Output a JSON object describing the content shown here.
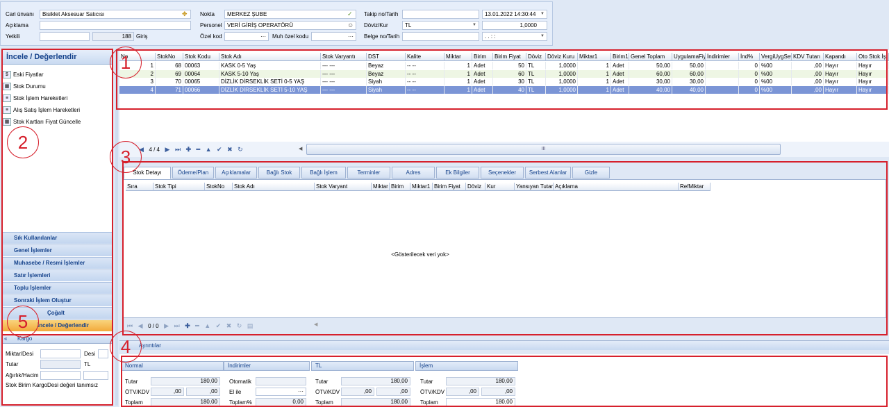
{
  "header": {
    "cari_label": "Cari ünvanı",
    "cari_value": "Bisiklet Aksesuar Satıcısı",
    "aciklama_label": "Açıklama",
    "yetkili_label": "Yetkili",
    "yetkili_num": "188",
    "giris_label": "Giriş",
    "nokta_label": "Nokta",
    "nokta_value": "MERKEZ ŞUBE",
    "personel_label": "Personel",
    "personel_value": "VERİ GİRİŞ OPERATÖRÜ",
    "ozelkod_label": "Özel kod",
    "ozelkod_dots": "···",
    "muhozel_label": "Muh özel kodu",
    "muhozel_dots": "···",
    "takip_label": "Takip no/Tarih",
    "takip_date": "13.01.2022 14:30:44",
    "doviz_label": "Döviz/Kur",
    "doviz_value": "TL",
    "kur_value": "1,0000",
    "belge_label": "Belge no/Tarih",
    "belge_date": ". .    : :"
  },
  "left": {
    "title": "İncele / Değerlendir",
    "items": [
      {
        "label": "Eski Fiyatlar"
      },
      {
        "label": "Stok Durumu"
      },
      {
        "label": "Stok İşlem Hareketleri"
      },
      {
        "label": "Alış Satış İşlem Hareketleri"
      },
      {
        "label": "Stok Kartları Fiyat Güncelle"
      }
    ],
    "accordion": [
      "Sık Kullanılanlar",
      "Genel İşlemler",
      "Muhasebe / Resmi İşlemler",
      "Satır İşlemleri",
      "Toplu İşlemler",
      "Sonraki İşlem Oluştur",
      "Çoğalt",
      "İncele / Değerlendir"
    ],
    "kargo_title": "Kargo",
    "kargo_miktar": "Miktar/Desi",
    "kargo_desi": "Desi",
    "kargo_tutar": "Tutar",
    "kargo_tl": "TL",
    "kargo_agirlik": "Ağırlık/Hacim",
    "kargo_msg": "Stok Birim KargoDesi değeri tanımsız"
  },
  "main_grid": {
    "columns": [
      "No",
      "StokNo",
      "Stok Kodu",
      "Stok Adı",
      "Stok Varyantı",
      "DST",
      "Kalite",
      "Miktar",
      "Birim",
      "Birim Fiyat",
      "Döviz",
      "Döviz Kuru",
      "Miktar1",
      "Birim1",
      "Genel Toplam",
      "UygulamaFiy",
      "İndirimler",
      "İnd%",
      "VergiUygSet",
      "KDV Tutarı",
      "Kapandı",
      "Oto Stok İşl"
    ],
    "rows": [
      [
        "1",
        "68",
        "00063",
        "KASK 0-5 Yaş",
        "--- ---",
        "Beyaz",
        "-- --",
        "1",
        "Adet",
        "50",
        "TL",
        "1,0000",
        "1",
        "Adet",
        "50,00",
        "50,00",
        "",
        "0",
        "%00",
        ",00",
        "Hayır",
        "Hayır"
      ],
      [
        "2",
        "69",
        "00064",
        "KASK 5-10 Yaş",
        "--- ---",
        "Beyaz",
        "-- --",
        "1",
        "Adet",
        "60",
        "TL",
        "1,0000",
        "1",
        "Adet",
        "60,00",
        "60,00",
        "",
        "0",
        "%00",
        ",00",
        "Hayır",
        "Hayır"
      ],
      [
        "3",
        "70",
        "00065",
        "DİZLİK DİRSEKLİK SETİ 0-5 YAŞ",
        "--- ---",
        "Siyah",
        "-- --",
        "1",
        "Adet",
        "30",
        "TL",
        "1,0000",
        "1",
        "Adet",
        "30,00",
        "30,00",
        "",
        "0",
        "%00",
        ",00",
        "Hayır",
        "Hayır"
      ],
      [
        "4",
        "71",
        "00066",
        "DİZLİK DİRSEKLİK SETİ  5-10 YAŞ",
        "--- ---",
        "Siyah",
        "-- --",
        "1",
        "Adet",
        "40",
        "TL",
        "1,0000",
        "1",
        "Adet",
        "40,00",
        "40,00",
        "",
        "0",
        "%00",
        ",00",
        "Hayır",
        "Hayır"
      ]
    ],
    "pager": "4 / 4",
    "scroll_grip": "III"
  },
  "tabs": [
    "Stok Detayı",
    "Ödeme/Plan",
    "Açıklamalar",
    "Bağlı Stok",
    "Bağlı İşlem",
    "Terminler",
    "Adres",
    "Ek Bilgiler",
    "Seçenekler",
    "Serbest Alanlar",
    "Gizle"
  ],
  "detail_grid": {
    "columns": [
      "Sıra",
      "Stok Tipi",
      "StokNo",
      "Stok Adı",
      "Stok Varyant",
      "Miktar",
      "Birim",
      "Miktar1",
      "Birim Fiyat",
      "Döviz",
      "Kur",
      "Yansıyan Tutar",
      "Açıklama",
      "RefMiktar"
    ],
    "empty_text": "<Gösterilecek veri yok>",
    "pager": "0 / 0"
  },
  "ayrintilar": "Ayrıntılar",
  "summary": {
    "sections": [
      "Normal",
      "İndirimler",
      "TL",
      "İşlem"
    ],
    "tutar": "Tutar",
    "otv": "ÖTV/KDV",
    "toplam": "Toplam",
    "otomatik": "Otomatik",
    "elile": "El ile",
    "toplam_pct": "Toplam%",
    "normal_tutar": "180,00",
    "normal_otv1": ",00",
    "normal_otv2": ",00",
    "normal_toplam": "180,00",
    "ind_toplam": "0,00",
    "tl_tutar": "180,00",
    "tl_otv1": ",00",
    "tl_otv2": ",00",
    "tl_toplam": "180,00",
    "islem_tutar": "180,00",
    "islem_otv1": ",00",
    "islem_otv2": ",00",
    "islem_toplam": "180,00"
  },
  "markers": [
    "1",
    "2",
    "3",
    "4",
    "5"
  ]
}
